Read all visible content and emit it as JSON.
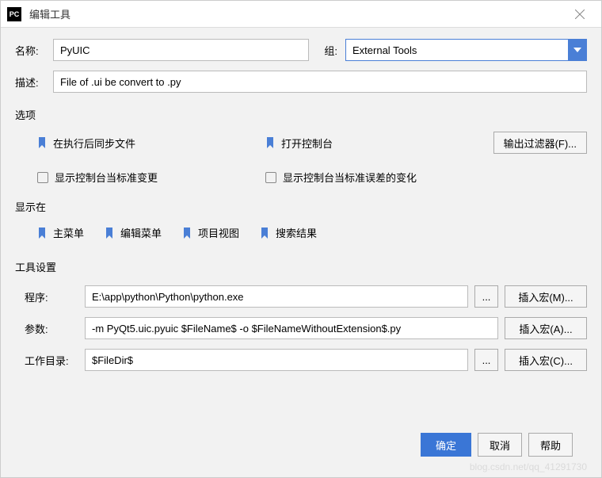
{
  "titlebar": {
    "title": "编辑工具"
  },
  "fields": {
    "name_label": "名称:",
    "name_value": "PyUIC",
    "group_label": "组:",
    "group_value": "External Tools",
    "desc_label": "描述:",
    "desc_value": "File of .ui be convert to .py"
  },
  "options": {
    "section": "选项",
    "sync_after_exec": "在执行后同步文件",
    "open_console": "打开控制台",
    "output_filters_btn": "输出过滤器(F)...",
    "show_console_std_change": "显示控制台当标准变更",
    "show_console_stderr_change": "显示控制台当标准误差的变化"
  },
  "show_in": {
    "section": "显示在",
    "main_menu": "主菜单",
    "edit_menu": "编辑菜单",
    "project_view": "项目视图",
    "search_results": "搜索结果"
  },
  "toolset": {
    "section": "工具设置",
    "program_label": "程序:",
    "program_value": "E:\\app\\python\\Python\\python.exe",
    "args_label": "参数:",
    "args_value": "-m PyQt5.uic.pyuic $FileName$ -o $FileNameWithoutExtension$.py",
    "workdir_label": "工作目录:",
    "workdir_value": "$FileDir$",
    "browse": "...",
    "macro_m": "插入宏(M)...",
    "macro_a": "插入宏(A)...",
    "macro_c": "插入宏(C)..."
  },
  "footer": {
    "ok": "确定",
    "cancel": "取消",
    "help": "帮助"
  },
  "watermark": "blog.csdn.net/qq_41291730"
}
